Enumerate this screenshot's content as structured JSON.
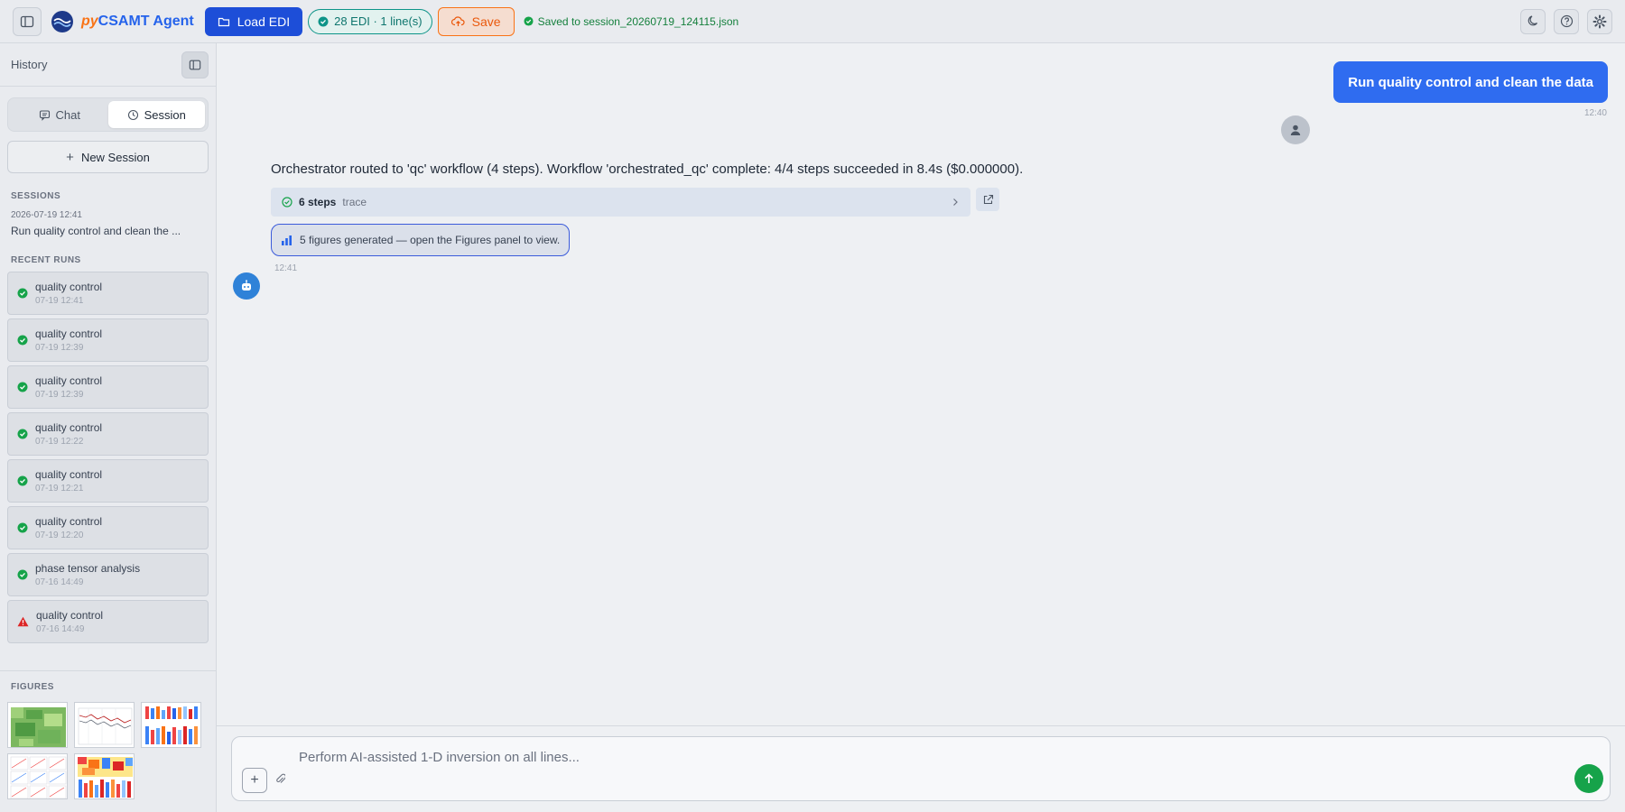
{
  "topbar": {
    "brand_py": "py",
    "brand_rest": "CSAMT Agent",
    "load_label": "Load EDI",
    "edi_badge": "28 EDI · 1 line(s)",
    "save_label": "Save",
    "saved_status": "Saved to session_20260719_124115.json"
  },
  "sidebar": {
    "title": "History",
    "tabs": [
      "Chat",
      "Session"
    ],
    "active_tab": "Session",
    "new_session_label": "New Session",
    "sessions_label": "SESSIONS",
    "session": {
      "date": "2026-07-19 12:41",
      "name": "Run quality control and clean the ..."
    },
    "recent_runs_label": "RECENT RUNS",
    "runs": [
      {
        "name": "quality control",
        "time": "07-19 12:41",
        "status": "success"
      },
      {
        "name": "quality control",
        "time": "07-19 12:39",
        "status": "success"
      },
      {
        "name": "quality control",
        "time": "07-19 12:39",
        "status": "success"
      },
      {
        "name": "quality control",
        "time": "07-19 12:22",
        "status": "success"
      },
      {
        "name": "quality control",
        "time": "07-19 12:21",
        "status": "success"
      },
      {
        "name": "quality control",
        "time": "07-19 12:20",
        "status": "success"
      },
      {
        "name": "phase tensor analysis",
        "time": "07-16 14:49",
        "status": "success"
      },
      {
        "name": "quality control",
        "time": "07-16 14:49",
        "status": "error"
      }
    ],
    "figures_label": "FIGURES",
    "figures": [
      "heatmap-green",
      "profile-lines",
      "bar-multicolor",
      "scatter-grid",
      "heatmap-warm"
    ]
  },
  "chat": {
    "user_message": "Run quality control and clean the data",
    "user_time": "12:40",
    "agent_message": "Orchestrator routed to 'qc' workflow (4 steps). Workflow 'orchestrated_qc' complete: 4/4 steps succeeded in 8.4s ($0.000000).",
    "trace_steps": "6 steps",
    "trace_label": "trace",
    "figures_notice": "5 figures generated — open the Figures panel to view.",
    "agent_time": "12:41"
  },
  "composer": {
    "placeholder": "Perform AI-assisted 1-D inversion on all lines..."
  },
  "colors": {
    "primary": "#1d4ed8",
    "user_bubble": "#2f6cf0",
    "success": "#16a34a",
    "error": "#dc2626",
    "save_accent": "#f97316"
  }
}
